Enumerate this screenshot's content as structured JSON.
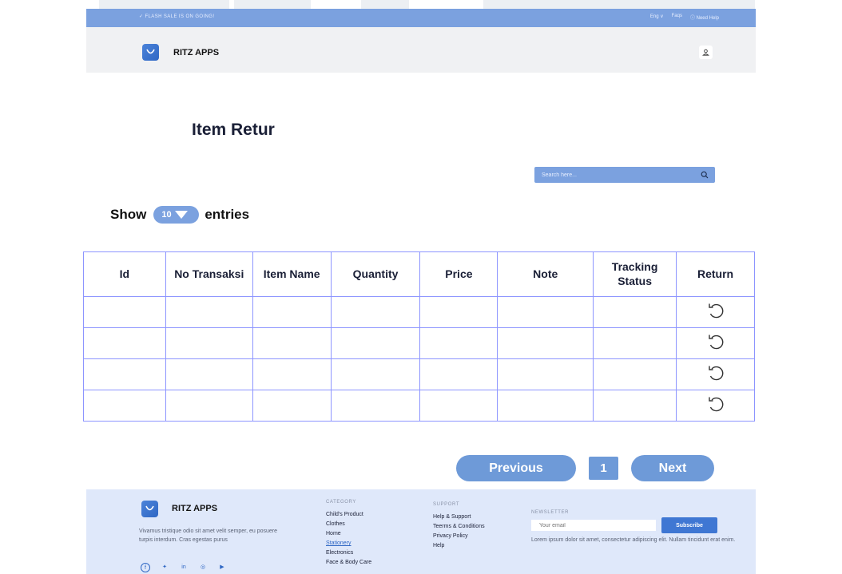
{
  "announcement": {
    "flash": "✓  FLASH SALE IS ON GOING!",
    "language": "Eng ∨",
    "faqs": "Faqs",
    "help": "ⓘ Need Help"
  },
  "header": {
    "brand": "RITZ APPS"
  },
  "page": {
    "title": "Item Retur"
  },
  "search": {
    "placeholder": "Search here..."
  },
  "entries": {
    "show_label": "Show",
    "selected": "10",
    "entries_label": "entries"
  },
  "table": {
    "columns": [
      "Id",
      "No Transaksi",
      "Item Name",
      "Quantity",
      "Price",
      "Note",
      "Tracking Status",
      "Return"
    ],
    "rows": [
      [
        "",
        "",
        "",
        "",
        "",
        "",
        ""
      ],
      [
        "",
        "",
        "",
        "",
        "",
        "",
        ""
      ],
      [
        "",
        "",
        "",
        "",
        "",
        "",
        ""
      ],
      [
        "",
        "",
        "",
        "",
        "",
        "",
        ""
      ]
    ],
    "return_icon": "return-icon"
  },
  "pagination": {
    "previous": "Previous",
    "current_page": "1",
    "next": "Next"
  },
  "footer": {
    "brand": "RITZ APPS",
    "description": "Vivamus tristique odio sit amet velit semper, eu posuere turpis interdum. Cras egestas purus",
    "category": {
      "heading": "CATEGORY",
      "items": [
        "Child's Product",
        "Clothes",
        "Home",
        "Stationery",
        "Electronics",
        "Face & Body Care"
      ]
    },
    "support": {
      "heading": "SUPPORT",
      "items": [
        "Help & Support",
        "Teerms & Conditions",
        "Privacy Policy",
        "Help"
      ]
    },
    "newsletter": {
      "heading": "NEWSLETTER",
      "email_placeholder": "Your email",
      "subscribe": "Subscribe",
      "note": "Lorem ipsum dolor sit amet, consectetur adipiscing elit. Nullam tincidunt erat enim."
    }
  },
  "colors": {
    "primary": "#7ba1df",
    "button": "#6e9ad8",
    "table_border": "#8d95ff",
    "footer_bg": "#dfe8fa"
  }
}
